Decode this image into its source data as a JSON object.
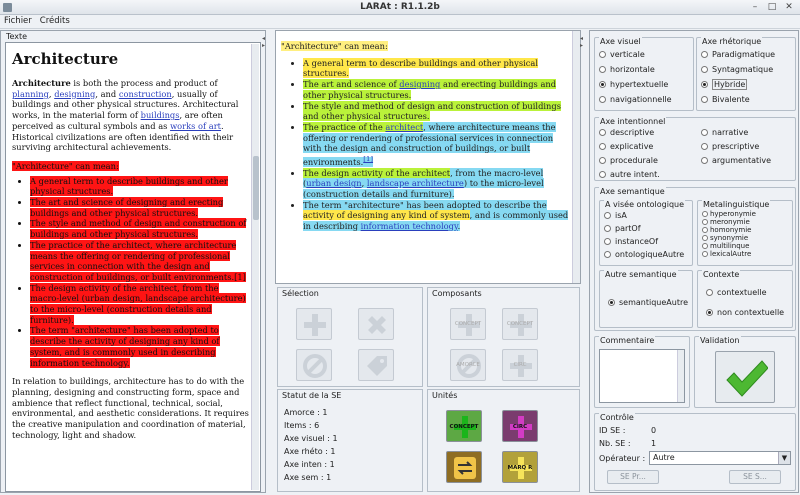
{
  "window": {
    "title": "LARAt : R1.1.2b"
  },
  "menu": [
    "Fichier",
    "Crédits"
  ],
  "left": {
    "panel_label": "Texte",
    "heading": "Architecture",
    "intro_parts": [
      "Architecture",
      " is both the process and product of ",
      "planning",
      ", ",
      "designing",
      ", and ",
      "construction",
      ", usually of buildings and other physical structures. Architectural works, in the material form of ",
      "buildings",
      ", are often perceived as cultural symbols and as ",
      "works of art",
      ". Historical civilizations are often identified with their surviving architectural achievements."
    ],
    "means_label": "\"Architecture\" can mean:",
    "bullets": [
      "A general term to describe buildings and other physical structures.",
      "The art and science of designing and erecting buildings and other physical structures.",
      "The style and method of design and construction of buildings and other physical structures.",
      "The practice of the architect, where architecture means the offering or rendering of professional services in connection with the design and construction of buildings, or built environments.[1]",
      "The design activity of the architect, from the macro-level (urban design, landscape architecture) to the micro-level (construction details and furniture).",
      "The term \"architecture\" has been adopted to describe the activity of designing any kind of system, and is commonly used in describing information technology."
    ],
    "outro": "In relation to buildings, architecture has to do with the planning, designing and constructing form, space and ambience that reflect functional, technical, social, environmental, and aesthetic considerations. It requires the creative manipulation and coordination of material, technology, light and shadow."
  },
  "middle": {
    "means_label": "\"Architecture\" can mean:",
    "b1": "A general term to describe buildings and other physical structures.",
    "b2a": "The art and science of ",
    "b2link": "designing",
    "b2b": " and erecting buildings and other physical structures.",
    "b3": "The style and method of design and construction of buildings and other physical structures.",
    "b4a": "The practice of the ",
    "b4link": "architect",
    "b4b": ", where architecture means the offering or rendering of professional services in connection with the design and construction of buildings, or built environments.",
    "b4ref": "[1]",
    "b5a": "The design activity of the architect",
    "b5b": ", from the macro-level (",
    "b5l1": "urban design",
    "b5c": ", ",
    "b5l2": "landscape architecture",
    "b5d": ") to the micro-level (construction details and furniture).",
    "b6a": "The term \"architecture\" has been adopted to describe the ",
    "b6b": "activity of designing any kind of system",
    "b6c": ", and is commonly used in describing ",
    "b6link": "information technology",
    "b6d": "."
  },
  "selection": {
    "title": "Sélection"
  },
  "composants": {
    "title": "Composants",
    "buttons": [
      "CONCEPT",
      "CONCEPT",
      "AMORCE",
      "CIRC"
    ]
  },
  "statut": {
    "title": "Statut de la SE",
    "rows": [
      "Amorce : 1",
      "Items : 6",
      "Axe visuel : 1",
      "Axe rhéto : 1",
      "Axe inten : 1",
      "Axe sem : 1"
    ]
  },
  "unites": {
    "title": "Unités",
    "buttons": [
      "CONCEPT",
      "CIRC",
      "",
      "MARQ R"
    ]
  },
  "right": {
    "axe_visuel": {
      "title": "Axe visuel",
      "options": [
        "verticale",
        "horizontale",
        "hypertextuelle",
        "navigationnelle"
      ],
      "selected": 2
    },
    "axe_rhetorique": {
      "title": "Axe rhétorique",
      "options": [
        "Paradigmatique",
        "Syntagmatique",
        "Hybride",
        "Bivalente"
      ],
      "selected": 2
    },
    "axe_intentionnel": {
      "title": "Axe intentionnel",
      "col1": [
        "descriptive",
        "explicative",
        "procedurale",
        "autre intent."
      ],
      "col2": [
        "narrative",
        "prescriptive",
        "argumentative"
      ]
    },
    "axe_semantique": {
      "title": "Axe semantique"
    },
    "visee_ontologique": {
      "title": "A visée ontologique",
      "options": [
        "isA",
        "partOf",
        "instanceOf",
        "ontologiqueAutre"
      ]
    },
    "metalinguistique": {
      "title": "Metalinguistique",
      "options": [
        "hyperonymie",
        "meronymie",
        "homonymie",
        "synonymie",
        "multilinque",
        "lexicalAutre"
      ]
    },
    "autre_semantique": {
      "title": "Autre semantique",
      "option": "semantiqueAutre"
    },
    "contexte": {
      "title": "Contexte",
      "options": [
        "contextuelle",
        "non contextuelle"
      ],
      "selected": 1
    },
    "commentaire": {
      "title": "Commentaire"
    },
    "validation": {
      "title": "Validation"
    },
    "controle": {
      "title": "Contrôle",
      "id_label": "ID SE :",
      "id_value": "0",
      "nb_label": "Nb. SE :",
      "nb_value": "1",
      "operateur_label": "Opérateur :",
      "operateur_value": "Autre",
      "prev": "SE Pr...",
      "next": "SE S..."
    }
  },
  "colors": {
    "red": "#ff1414",
    "yellow": "#ffe74a",
    "green": "#baf23a",
    "cyan": "#86d9f2",
    "accent": "#4db832"
  }
}
